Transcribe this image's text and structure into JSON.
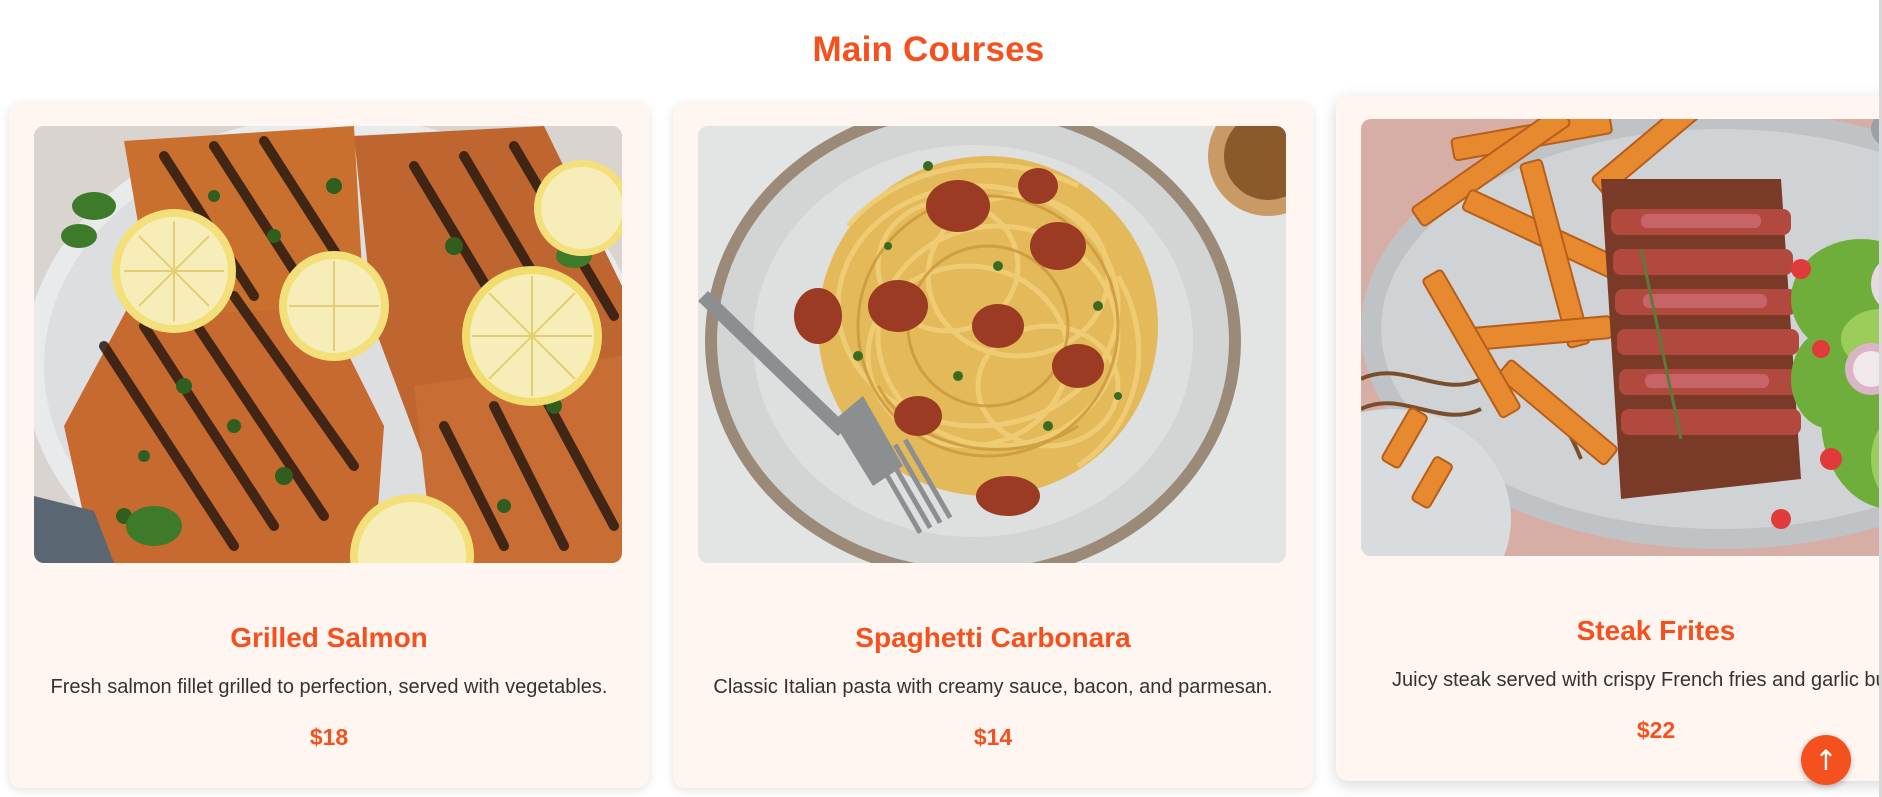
{
  "section": {
    "title": "Main Courses"
  },
  "menu_items": [
    {
      "name": "Grilled Salmon",
      "description": "Fresh salmon fillet grilled to perfection, served with vegetables.",
      "price": "$18",
      "image_icon": "grilled-salmon-photo"
    },
    {
      "name": "Spaghetti Carbonara",
      "description": "Classic Italian pasta with creamy sauce, bacon, and parmesan.",
      "price": "$14",
      "image_icon": "spaghetti-carbonara-photo"
    },
    {
      "name": "Steak Frites",
      "description": "Juicy steak served with crispy French fries and garlic butter.",
      "price": "$22",
      "image_icon": "steak-frites-photo"
    }
  ],
  "scroll_top": {
    "glyph": "↑"
  },
  "colors": {
    "accent": "#f4511e",
    "card_background": "#fff6f1",
    "text": "#333333"
  }
}
